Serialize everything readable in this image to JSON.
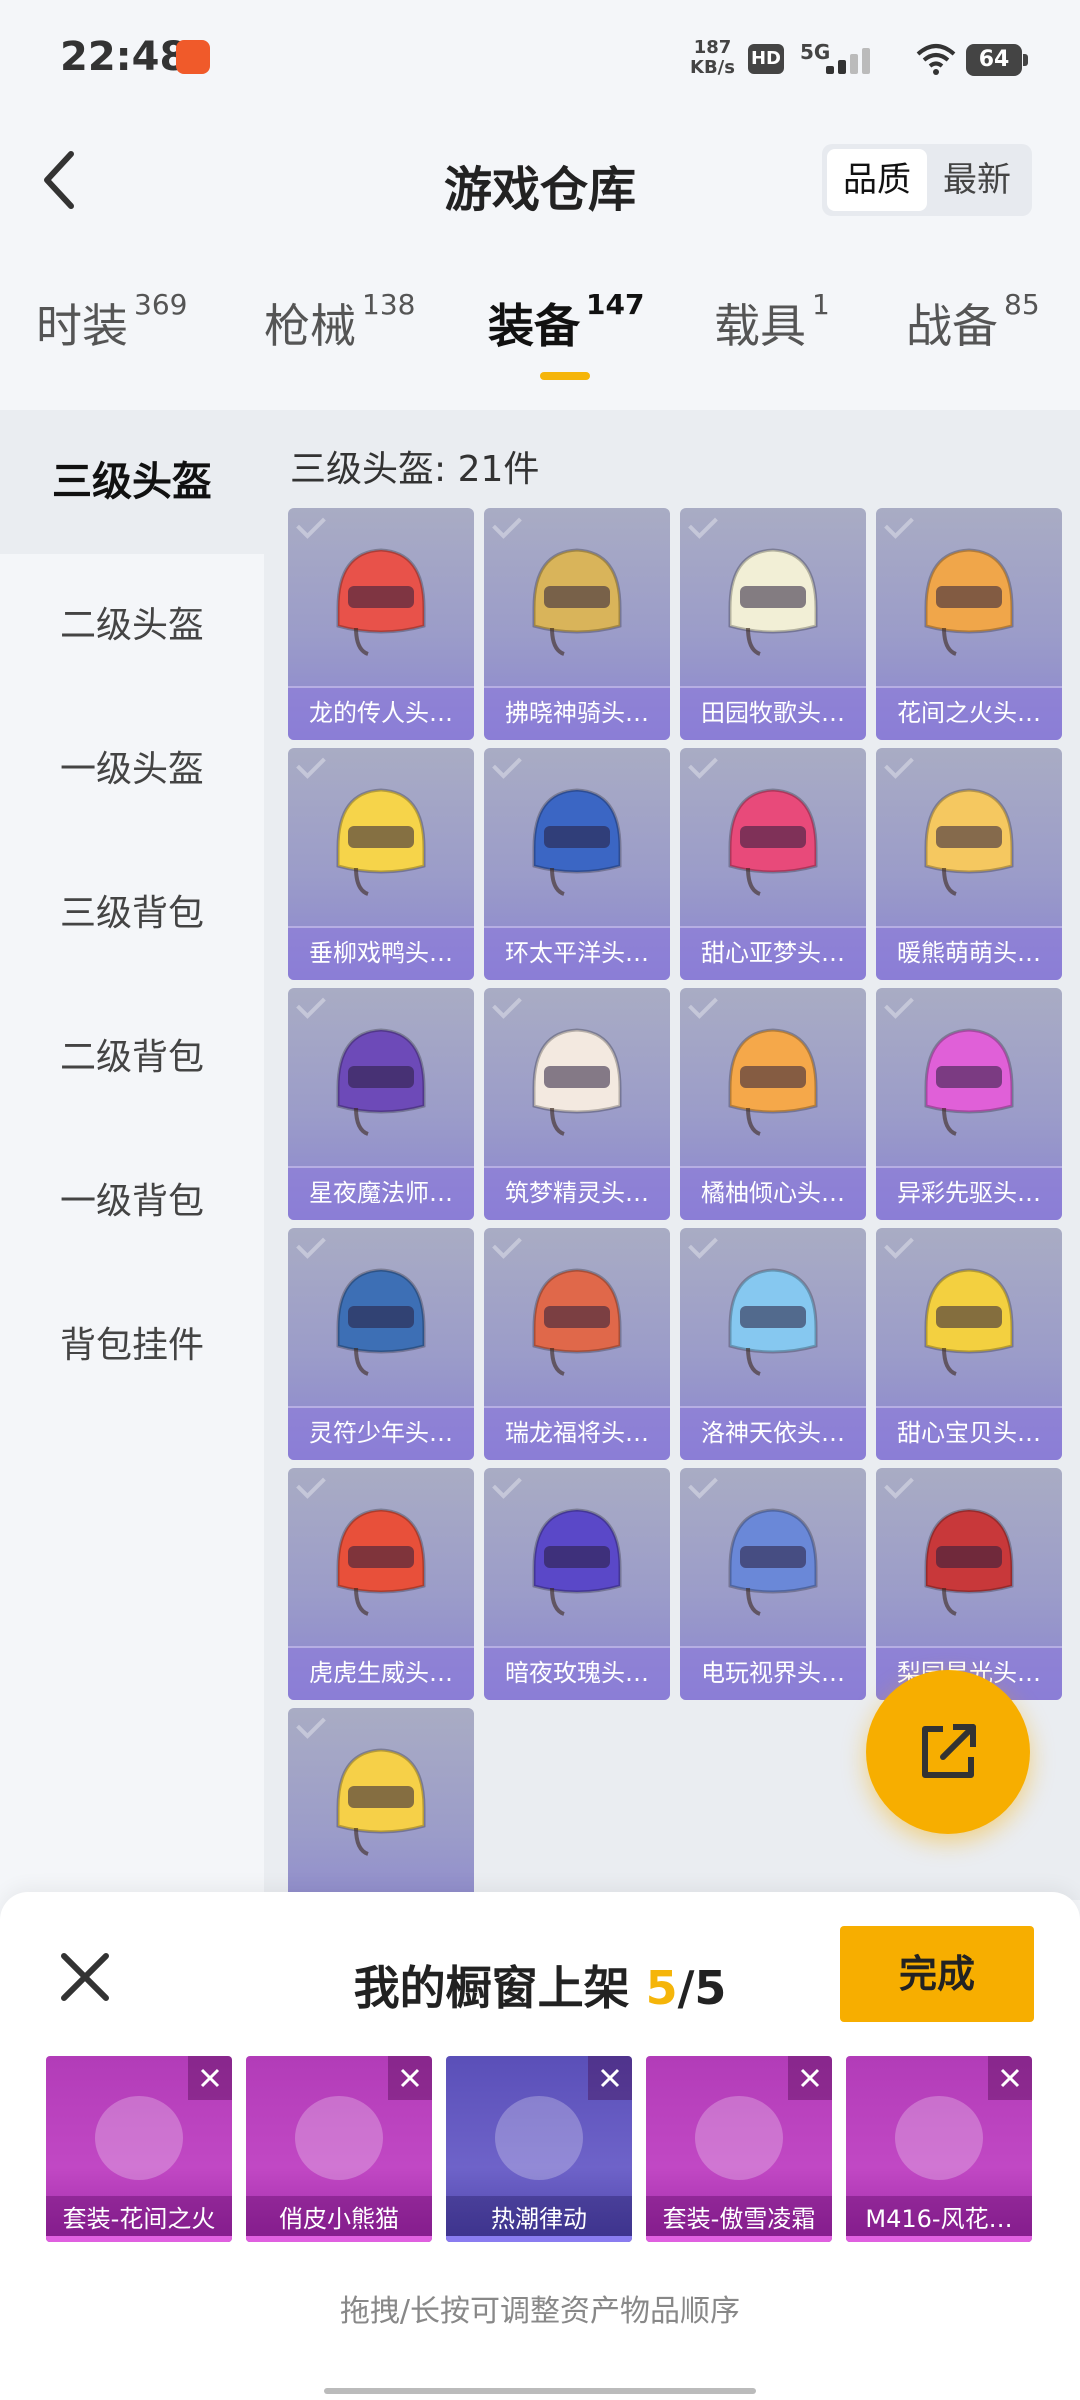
{
  "status_bar": {
    "time": "22:48",
    "net_speed_value": "187",
    "net_speed_unit": "KB/s",
    "hd_badge": "HD",
    "network": "5G",
    "battery": "64"
  },
  "header": {
    "title": "游戏仓库",
    "sort_options": [
      "品质",
      "最新"
    ],
    "sort_active": "品质"
  },
  "tabs": [
    {
      "label": "时装",
      "count": "369"
    },
    {
      "label": "枪械",
      "count": "138"
    },
    {
      "label": "装备",
      "count": "147"
    },
    {
      "label": "载具",
      "count": "1"
    },
    {
      "label": "战备",
      "count": "85"
    }
  ],
  "active_tab": "装备",
  "sidebar": {
    "items": [
      "三级头盔",
      "二级头盔",
      "一级头盔",
      "三级背包",
      "二级背包",
      "一级背包",
      "背包挂件"
    ],
    "active": "三级头盔"
  },
  "main": {
    "section_title": "三级头盔: 21件",
    "items": [
      {
        "label": "龙的传人头…",
        "color": "#e8524a"
      },
      {
        "label": "拂晓神骑头…",
        "color": "#d9b45a"
      },
      {
        "label": "田园牧歌头…",
        "color": "#f2efd6"
      },
      {
        "label": "花间之火头…",
        "color": "#f0a64a"
      },
      {
        "label": "垂柳戏鸭头…",
        "color": "#f6d44a"
      },
      {
        "label": "环太平洋头…",
        "color": "#3b66c4"
      },
      {
        "label": "甜心亚梦头…",
        "color": "#e84a7a"
      },
      {
        "label": "暖熊萌萌头…",
        "color": "#f5c860"
      },
      {
        "label": "星夜魔法师…",
        "color": "#6d4ab8"
      },
      {
        "label": "筑梦精灵头…",
        "color": "#f3e9e0"
      },
      {
        "label": "橘柚倾心头…",
        "color": "#f5a84a"
      },
      {
        "label": "异彩先驱头…",
        "color": "#e060d8"
      },
      {
        "label": "灵符少年头…",
        "color": "#3d6fb5"
      },
      {
        "label": "瑞龙福将头…",
        "color": "#e0684a"
      },
      {
        "label": "洛神天依头…",
        "color": "#86c8f0"
      },
      {
        "label": "甜心宝贝头…",
        "color": "#f3d040"
      },
      {
        "label": "虎虎生威头…",
        "color": "#e8503a"
      },
      {
        "label": "暗夜玫瑰头…",
        "color": "#5a48c8"
      },
      {
        "label": "电玩视界头…",
        "color": "#6a88d8"
      },
      {
        "label": "梨园星光头…",
        "color": "#c8383a"
      },
      {
        "label": "",
        "color": "#f6d048"
      }
    ]
  },
  "fab": {
    "icon": "share-icon"
  },
  "sheet": {
    "title_prefix": "我的橱窗上架",
    "count_current": "5",
    "count_total": "/5",
    "done_label": "完成",
    "hint": "拖拽/长按可调整资产物品顺序",
    "items": [
      {
        "label": "套装-花间之火",
        "style": "purple"
      },
      {
        "label": "俏皮小熊猫",
        "style": "purple"
      },
      {
        "label": "热潮律动",
        "style": "blue"
      },
      {
        "label": "套装-傲雪凌霜",
        "style": "purple"
      },
      {
        "label": "M416-风花…",
        "style": "purple"
      }
    ]
  }
}
